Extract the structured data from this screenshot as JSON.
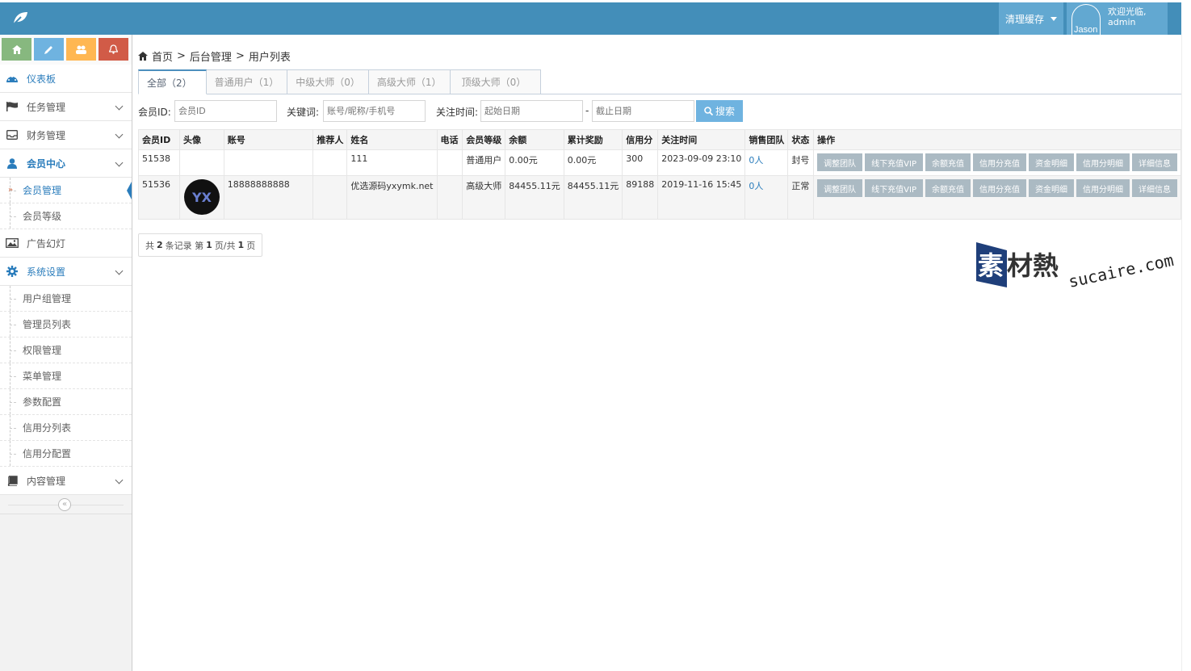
{
  "navbar": {
    "clear_cache": "清理缓存",
    "avatar_name": "Jason",
    "welcome": "欢迎光临,",
    "username": "admin"
  },
  "sidebar": {
    "items": [
      {
        "label": "仪表板",
        "icon": "dashboard-icon"
      },
      {
        "label": "任务管理",
        "icon": "flag-icon"
      },
      {
        "label": "财务管理",
        "icon": "inbox-icon"
      },
      {
        "label": "会员中心",
        "icon": "user-icon"
      },
      {
        "label": "广告幻灯",
        "icon": "picture-icon"
      },
      {
        "label": "系统设置",
        "icon": "gear-icon"
      },
      {
        "label": "内容管理",
        "icon": "book-icon"
      }
    ],
    "member_sub": [
      "会员管理",
      "会员等级"
    ],
    "system_sub": [
      "用户组管理",
      "管理员列表",
      "权限管理",
      "菜单管理",
      "参数配置",
      "信用分列表",
      "信用分配置"
    ]
  },
  "breadcrumb": [
    "首页",
    ">",
    "后台管理",
    ">",
    "用户列表"
  ],
  "tabs": [
    "全部（2）",
    "普通用户（1）",
    "中级大师（0）",
    "高级大师（1）",
    "顶级大师（0）"
  ],
  "search": {
    "member_id_label": "会员ID:",
    "member_id_placeholder": "会员ID",
    "keyword_label": "关键词:",
    "keyword_placeholder": "账号/昵称/手机号",
    "follow_time_label": "关注时间:",
    "start_placeholder": "起始日期",
    "dash": "-",
    "end_placeholder": "截止日期",
    "button": "搜索"
  },
  "table": {
    "headers": [
      "会员ID",
      "头像",
      "账号",
      "推荐人",
      "姓名",
      "电话",
      "会员等级",
      "余额",
      "累计奖励",
      "信用分",
      "关注时间",
      "销售团队",
      "状态",
      "操作"
    ],
    "rows": [
      {
        "id": "51538",
        "account": "",
        "referrer": "",
        "name": "111",
        "phone": "",
        "level": "普通用户",
        "balance": "0.00元",
        "reward": "0.00元",
        "credit": "300",
        "time": "2023-09-09 23:10",
        "team": "0人",
        "status": "封号",
        "avatar_text": ""
      },
      {
        "id": "51536",
        "account": "18888888888",
        "referrer": "",
        "name": "优选源码yxymk.net",
        "phone": "",
        "level": "高级大师",
        "balance": "84455.11元",
        "reward": "84455.11元",
        "credit": "89188",
        "time": "2019-11-16 15:45",
        "team": "0人",
        "status": "正常",
        "avatar_text": "YX"
      }
    ],
    "ops": [
      "调整团队",
      "线下充值VIP",
      "余额充值",
      "信用分充值",
      "资金明细",
      "信用分明细",
      "详细信息"
    ]
  },
  "pager": {
    "p1": "共",
    "total": "2",
    "p2": "条记录 第",
    "page": "1",
    "p3": "页/共",
    "pages": "1",
    "p4": "页"
  },
  "watermark": {
    "cn": "素材熱",
    "en": "sucaire.com"
  }
}
